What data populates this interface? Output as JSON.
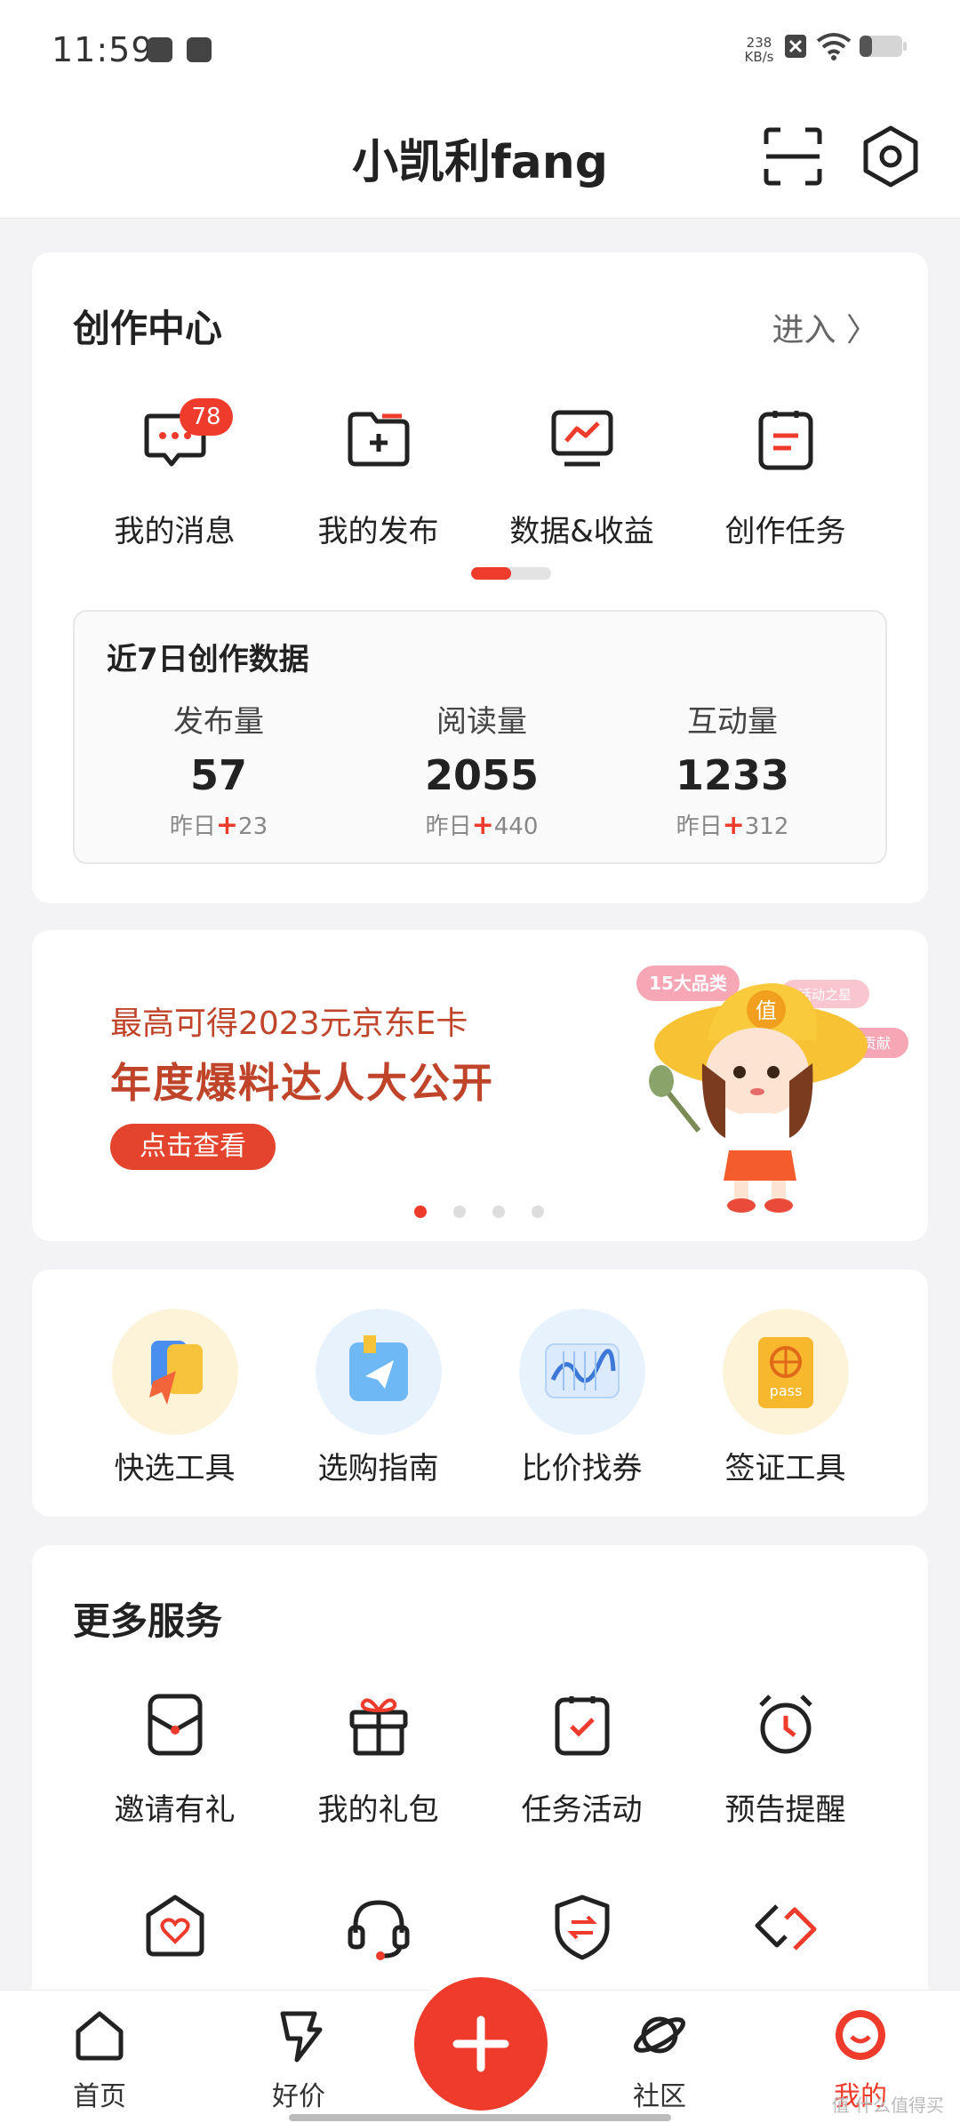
{
  "status_bar": {
    "time": "11:59",
    "net_speed_value": "238",
    "net_speed_unit": "KB/s"
  },
  "header": {
    "title": "小凯利fang",
    "scan_icon": "scan-icon",
    "settings_icon": "gear-icon"
  },
  "creator_center": {
    "title": "创作中心",
    "enter_label": "进入 〉",
    "items": [
      {
        "label": "我的消息",
        "icon": "message-icon",
        "badge": "78"
      },
      {
        "label": "我的发布",
        "icon": "folder-add-icon"
      },
      {
        "label": "数据&收益",
        "icon": "monitor-chart-icon"
      },
      {
        "label": "创作任务",
        "icon": "clipboard-icon"
      }
    ],
    "stats": {
      "title": "近7日创作数据",
      "items": [
        {
          "label": "发布量",
          "value": "57",
          "delta_prefix": "昨日",
          "delta": "23"
        },
        {
          "label": "阅读量",
          "value": "2055",
          "delta_prefix": "昨日",
          "delta": "440"
        },
        {
          "label": "互动量",
          "value": "1233",
          "delta_prefix": "昨日",
          "delta": "312"
        }
      ]
    }
  },
  "banner": {
    "line1": "最高可得2023元京东E卡",
    "line2": "年度爆料达人大公开",
    "button": "点击查看",
    "tag1": "15大品类",
    "tag2": "活动之星",
    "tag3": "标签贡献",
    "hat_text": "值"
  },
  "tools": [
    {
      "label": "快选工具",
      "icon": "quick-select-icon"
    },
    {
      "label": "选购指南",
      "icon": "guide-icon"
    },
    {
      "label": "比价找券",
      "icon": "price-compare-icon"
    },
    {
      "label": "签证工具",
      "icon": "passport-icon",
      "icon_text": "pass"
    }
  ],
  "more_services": {
    "title": "更多服务",
    "items": [
      {
        "label": "邀请有礼",
        "icon": "invite-icon"
      },
      {
        "label": "我的礼包",
        "icon": "gift-icon"
      },
      {
        "label": "任务活动",
        "icon": "task-icon"
      },
      {
        "label": "预告提醒",
        "icon": "alarm-icon"
      }
    ],
    "row2_icons": [
      "heart-home-icon",
      "headset-icon",
      "shield-exchange-icon",
      "link-icon"
    ]
  },
  "tabbar": {
    "items": [
      {
        "label": "首页",
        "icon": "home-icon"
      },
      {
        "label": "好价",
        "icon": "deal-icon"
      },
      {
        "label": "社区",
        "icon": "planet-icon"
      },
      {
        "label": "我的",
        "icon": "profile-icon"
      }
    ]
  },
  "watermark": "值 什么值得买",
  "colors": {
    "accent": "#ef3b2b",
    "banner_text": "#c0442a"
  }
}
